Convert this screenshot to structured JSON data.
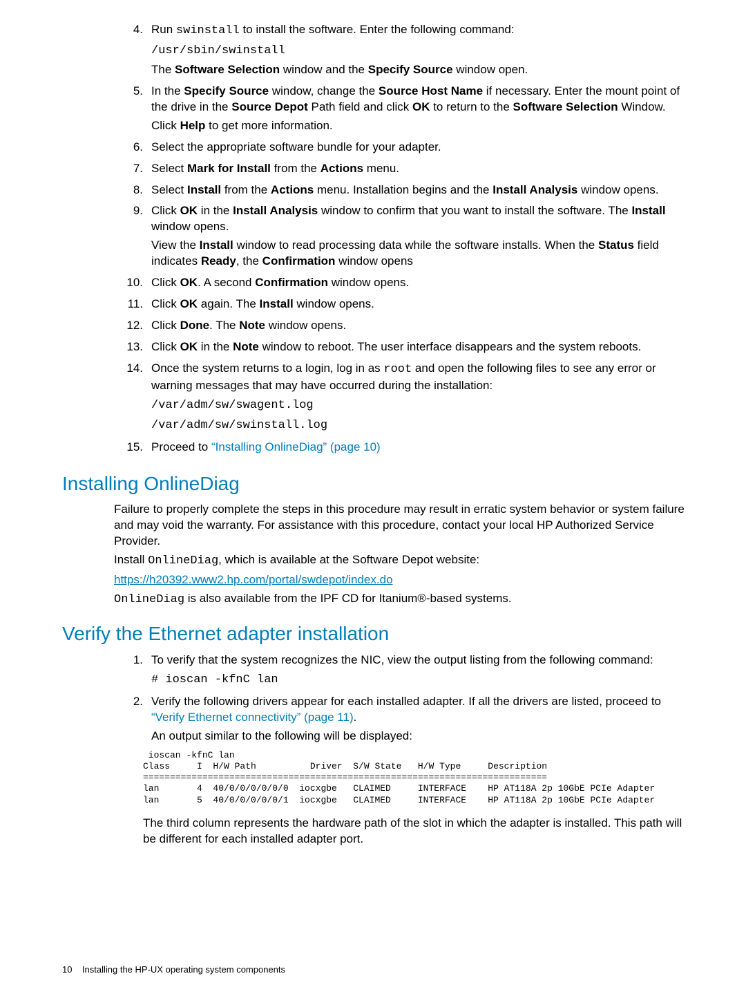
{
  "steps4_15": [
    {
      "n": "4.",
      "lines": [
        "Run <span class='mono'>swinstall</span> to install the software. Enter the following command:",
        "<span class='mono'>/usr/sbin/swinstall</span>",
        "The <b>Software Selection</b> window and the <b>Specify Source</b> window open."
      ]
    },
    {
      "n": "5.",
      "lines": [
        "In the <b>Specify Source</b> window, change the <b>Source Host Name</b> if necessary. Enter the mount point of the drive in the <b>Source Depot</b> Path field and click <b>OK</b> to return to the <b>Software Selection</b> Window.",
        "Click <b>Help</b> to get more information."
      ]
    },
    {
      "n": "6.",
      "lines": [
        "Select the appropriate software bundle for your adapter."
      ]
    },
    {
      "n": "7.",
      "lines": [
        "Select <b>Mark for Install</b> from the <b>Actions</b> menu."
      ]
    },
    {
      "n": "8.",
      "lines": [
        "Select <b>Install</b> from the <b>Actions</b> menu. Installation begins and the <b>Install Analysis</b> window opens."
      ]
    },
    {
      "n": "9.",
      "lines": [
        "Click <b>OK</b> in the <b>Install Analysis</b> window to confirm that you want to install the software. The <b>Install</b> window opens.",
        "View the <b>Install</b> window to read processing data while the software installs. When the <b>Status</b> field indicates <b>Ready</b>, the <b>Confirmation</b> window opens"
      ]
    },
    {
      "n": "10.",
      "lines": [
        "Click <b>OK</b>. A second <b>Confirmation</b> window opens."
      ]
    },
    {
      "n": "11.",
      "lines": [
        "Click <b>OK</b> again. The <b>Install</b> window opens."
      ]
    },
    {
      "n": "12.",
      "lines": [
        "Click <b>Done</b>. The <b>Note</b> window opens."
      ]
    },
    {
      "n": "13.",
      "lines": [
        "Click <b>OK</b> in the <b>Note</b> window to reboot. The user interface disappears and the system reboots."
      ]
    },
    {
      "n": "14.",
      "lines": [
        "Once the system returns to a login, log in as <span class='mono'>root</span> and open the following files to see any error or warning messages that may have occurred during the installation:",
        "<span class='mono'>/var/adm/sw/swagent.log</span>",
        "<span class='mono'>/var/adm/sw/swinstall.log</span>"
      ]
    },
    {
      "n": "15.",
      "lines": [
        "Proceed to <span class='link'>&ldquo;Installing OnlineDiag&rdquo; (page 10)</span>"
      ]
    }
  ],
  "h2a": "Installing OnlineDiag",
  "onlinediag_paras": [
    "Failure to properly complete the steps in this procedure may result in erratic system behavior or system failure and may void the warranty. For assistance with this procedure, contact your local HP Authorized Service Provider.",
    "Install <span class='mono'>OnlineDiag</span>, which is available at the Software Depot website:",
    "<span class='link-ul'>https://h20392.www2.hp.com/portal/swdepot/index.do</span>",
    "<span class='mono'>OnlineDiag</span> is also available from the IPF CD for Itanium&reg;-based systems."
  ],
  "h2b": "Verify the Ethernet adapter installation",
  "verify_steps": [
    {
      "n": "1.",
      "lines": [
        "To verify that the system recognizes the NIC, view the output listing from the following command:",
        "<span class='mono'># ioscan -kfnC lan</span>"
      ]
    },
    {
      "n": "2.",
      "lines": [
        "Verify the following drivers appear for each installed adapter. If all the drivers are listed, proceed to <span class='link'>&ldquo;Verify Ethernet connectivity&rdquo; (page 11)</span>.",
        "An output similar to the following will be displayed:"
      ]
    }
  ],
  "ioscan_output": " ioscan -kfnC lan\nClass     I  H/W Path          Driver  S/W State   H/W Type     Description\n===========================================================================\nlan       4  40/0/0/0/0/0/0  iocxgbe   CLAIMED     INTERFACE    HP AT118A 2p 10GbE PCIe Adapter\nlan       5  40/0/0/0/0/0/1  iocxgbe   CLAIMED     INTERFACE    HP AT118A 2p 10GbE PCIe Adapter",
  "closing_para": "The third column represents the hardware path of the slot in which the adapter is installed. This path will be different for each installed adapter port.",
  "footer_page": "10",
  "footer_text": "Installing the HP-UX operating system components"
}
